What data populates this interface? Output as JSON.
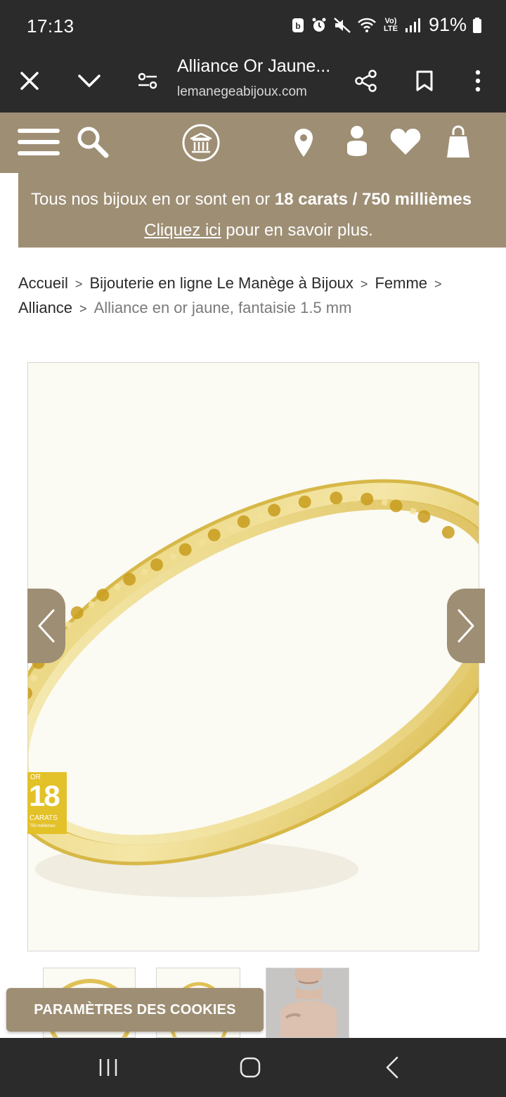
{
  "status_bar": {
    "time": "17:13",
    "battery": "91%",
    "network_label": "Vo) LTE"
  },
  "browser": {
    "title": "Alliance Or Jaune...",
    "url": "lemanegeabijoux.com",
    "icons": [
      "close-icon",
      "chevron-down-icon",
      "tune-icon",
      "share-icon",
      "bookmark-icon",
      "more-vert-icon"
    ]
  },
  "site_header": {
    "icons": [
      "menu-icon",
      "search-icon",
      "logo-icon",
      "location-icon",
      "account-icon",
      "favorite-icon",
      "cart-icon"
    ],
    "brand_color": "#9e8e74"
  },
  "promo": {
    "text_before": "Tous nos bijoux en or sont en or ",
    "text_bold": "18 carats / 750 millièmes",
    "link_text": "Cliquez ici",
    "text_after": " pour en savoir plus."
  },
  "breadcrumb": {
    "items": [
      "Accueil",
      "Bijouterie en ligne Le Manège à Bijoux",
      "Femme",
      "Alliance"
    ],
    "current": "Alliance en or jaune, fantaisie 1.5 mm",
    "separator": ">"
  },
  "product": {
    "badge": {
      "or": "OR",
      "number": "18",
      "carats": "CARATS",
      "millièmes": "750 millièmes"
    }
  },
  "cookie": {
    "label": "PARAMÈTRES DES COOKIES"
  }
}
